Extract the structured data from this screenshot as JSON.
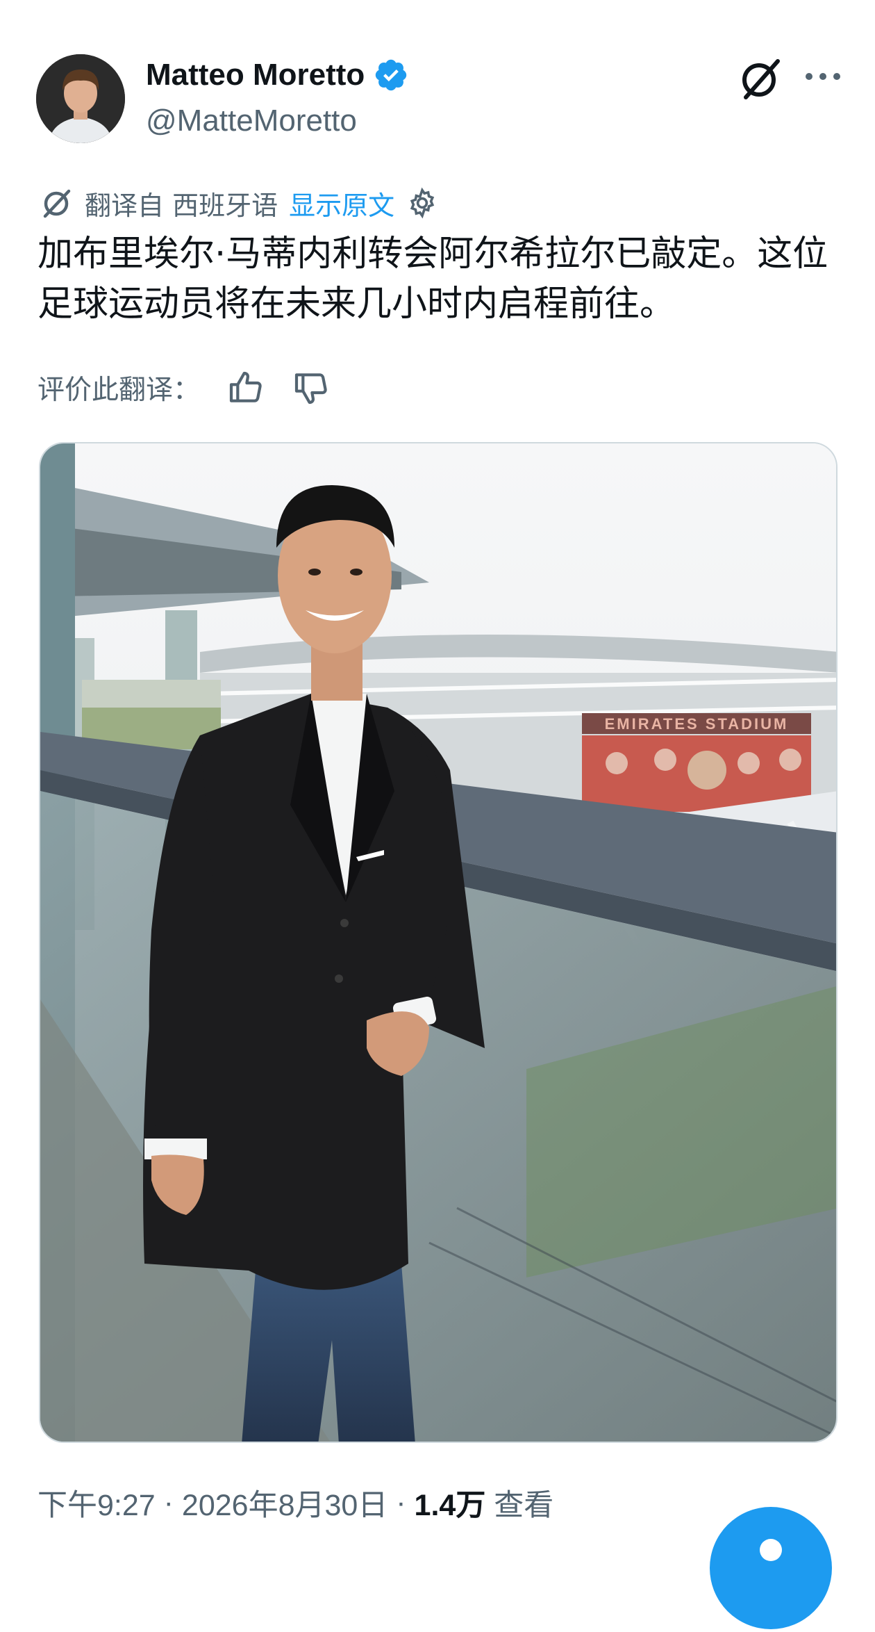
{
  "author": {
    "name": "Matteo Moretto",
    "handle": "@MatteMoretto"
  },
  "translation": {
    "source_label": "翻译自 西班牙语",
    "show_original": "显示原文",
    "rate_label": "评价此翻译："
  },
  "tweet": {
    "text": "加布里埃尔·马蒂内利转会阿尔希拉尔已敲定。这位足球运动员将在未来几小时内启程前往。"
  },
  "photo": {
    "stadium_sign": "EMIRATES STADIUM"
  },
  "meta": {
    "time": "下午9:27",
    "date": "2026年8月30日",
    "views_count": "1.4万",
    "views_label": "查看"
  },
  "colors": {
    "accent": "#1d9bf0",
    "secondary_text": "#536471",
    "primary_text": "#0f1419"
  },
  "icons": [
    "verified-badge-icon",
    "grok-icon",
    "more-icon",
    "translate-icon",
    "gear-icon",
    "thumbs-up-icon",
    "thumbs-down-icon",
    "compose-icon"
  ]
}
